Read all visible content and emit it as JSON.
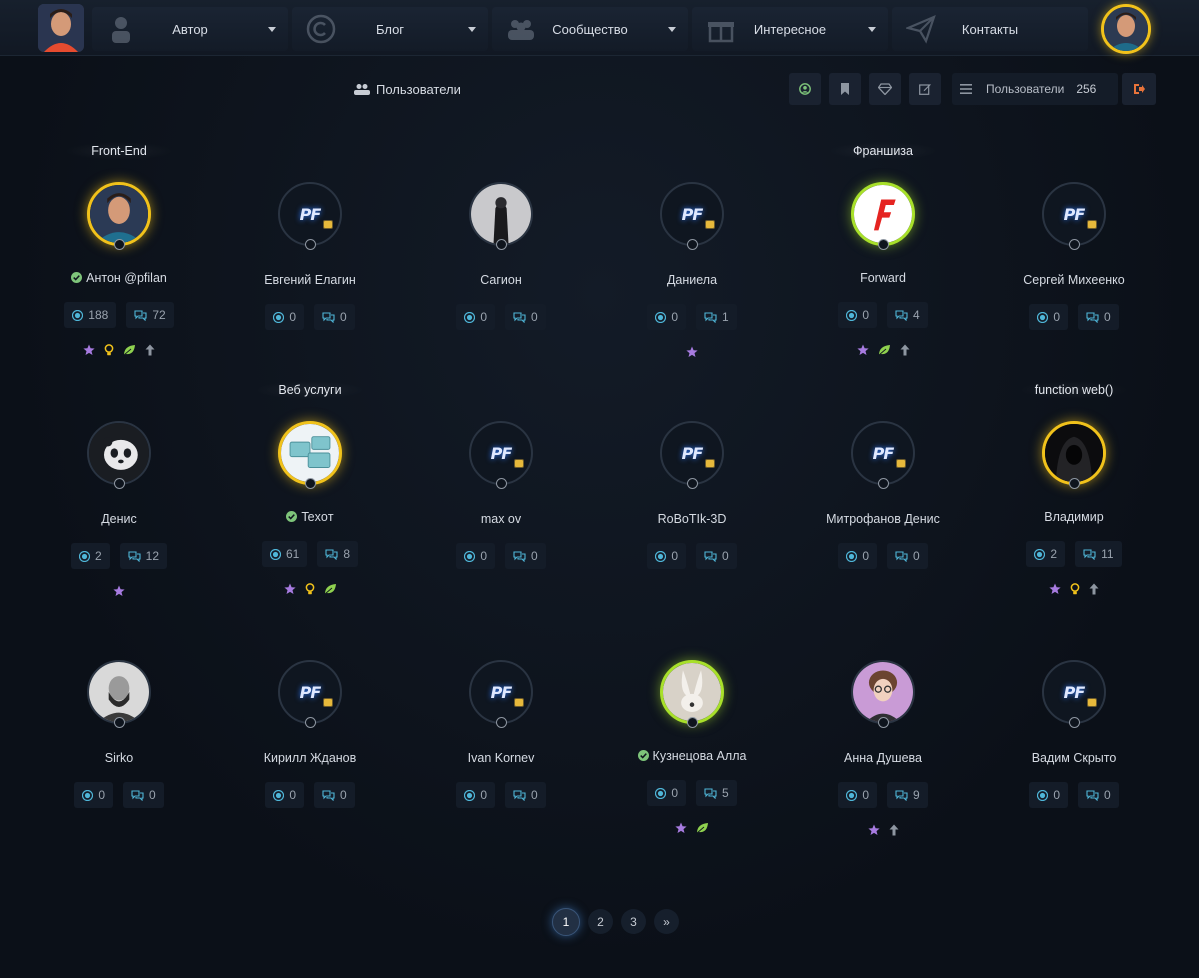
{
  "nav": {
    "items": [
      {
        "label": "Автор",
        "icon": "user-icon"
      },
      {
        "label": "Блог",
        "icon": "copyright-icon"
      },
      {
        "label": "Сообщество",
        "icon": "users-icon"
      },
      {
        "label": "Интересное",
        "icon": "gift-icon"
      },
      {
        "label": "Контакты",
        "icon": "paper-plane-icon"
      }
    ]
  },
  "subheader": {
    "title": "Пользователи",
    "count_label": "Пользователи",
    "count": "256"
  },
  "cards": [
    {
      "group": "Front-End",
      "name": "Антон @pfilan",
      "verified": true,
      "views": "188",
      "comments": "72",
      "badges": [
        "star",
        "bulb",
        "leaf",
        "up"
      ],
      "ring": "gold",
      "avatar": "photo-man"
    },
    {
      "group": "",
      "name": "Евгений Елагин",
      "verified": false,
      "views": "0",
      "comments": "0",
      "badges": [],
      "ring": "none",
      "avatar": "pf-logo"
    },
    {
      "group": "",
      "name": "Сагион",
      "verified": false,
      "views": "0",
      "comments": "0",
      "badges": [],
      "ring": "none",
      "avatar": "photo-dark"
    },
    {
      "group": "",
      "name": "Даниела",
      "verified": false,
      "views": "0",
      "comments": "1",
      "badges": [
        "star"
      ],
      "ring": "none",
      "avatar": "pf-logo"
    },
    {
      "group": "Франшиза",
      "name": "Forward",
      "verified": false,
      "views": "0",
      "comments": "4",
      "badges": [
        "star",
        "leaf",
        "up"
      ],
      "ring": "lime",
      "avatar": "forward-logo"
    },
    {
      "group": "",
      "name": "Сергей Михеенко",
      "verified": false,
      "views": "0",
      "comments": "0",
      "badges": [],
      "ring": "none",
      "avatar": "pf-logo"
    },
    {
      "group": "",
      "name": "Денис",
      "verified": false,
      "views": "2",
      "comments": "12",
      "badges": [
        "star"
      ],
      "ring": "none",
      "avatar": "panda"
    },
    {
      "group": "Веб услуги",
      "name": "Texoт",
      "verified": true,
      "views": "61",
      "comments": "8",
      "badges": [
        "star",
        "bulb",
        "leaf"
      ],
      "ring": "gold",
      "avatar": "screens"
    },
    {
      "group": "",
      "name": "max ov",
      "verified": false,
      "views": "0",
      "comments": "0",
      "badges": [],
      "ring": "none",
      "avatar": "pf-logo"
    },
    {
      "group": "",
      "name": "RoBoTIk-3D",
      "verified": false,
      "views": "0",
      "comments": "0",
      "badges": [],
      "ring": "none",
      "avatar": "pf-logo"
    },
    {
      "group": "",
      "name": "Митрофанов Денис",
      "verified": false,
      "views": "0",
      "comments": "0",
      "badges": [],
      "ring": "none",
      "avatar": "pf-logo"
    },
    {
      "group": "function web()",
      "name": "Владимир",
      "verified": false,
      "views": "2",
      "comments": "11",
      "badges": [
        "star",
        "bulb",
        "up"
      ],
      "ring": "gold",
      "avatar": "hood"
    },
    {
      "group": "",
      "name": "Sirko",
      "verified": false,
      "views": "0",
      "comments": "0",
      "badges": [],
      "ring": "none",
      "avatar": "photo-beard"
    },
    {
      "group": "",
      "name": "Кирилл Жданов",
      "verified": false,
      "views": "0",
      "comments": "0",
      "badges": [],
      "ring": "none",
      "avatar": "pf-logo"
    },
    {
      "group": "",
      "name": "Ivan Kornev",
      "verified": false,
      "views": "0",
      "comments": "0",
      "badges": [],
      "ring": "none",
      "avatar": "pf-logo"
    },
    {
      "group": "",
      "name": "Кузнецова Алла",
      "verified": true,
      "views": "0",
      "comments": "5",
      "badges": [
        "star",
        "leaf"
      ],
      "ring": "lime",
      "avatar": "bunny"
    },
    {
      "group": "",
      "name": "Анна Душева",
      "verified": false,
      "views": "0",
      "comments": "9",
      "badges": [
        "star",
        "up"
      ],
      "ring": "none",
      "avatar": "girl"
    },
    {
      "group": "",
      "name": "Вадим Скрыто",
      "verified": false,
      "views": "0",
      "comments": "0",
      "badges": [],
      "ring": "none",
      "avatar": "pf-logo"
    }
  ],
  "avatar_text": {
    "pf": "PF"
  },
  "pagination": {
    "pages": [
      "1",
      "2",
      "3"
    ],
    "next": "»",
    "active": "1"
  },
  "colors": {
    "gold": "#f1c21b",
    "lime": "#a8e02a",
    "star": "#a77be0",
    "bulb": "#f1c21b",
    "leaf": "#8fd14f",
    "up": "#8e96a1",
    "stat_icon": "#4fb6d8"
  }
}
